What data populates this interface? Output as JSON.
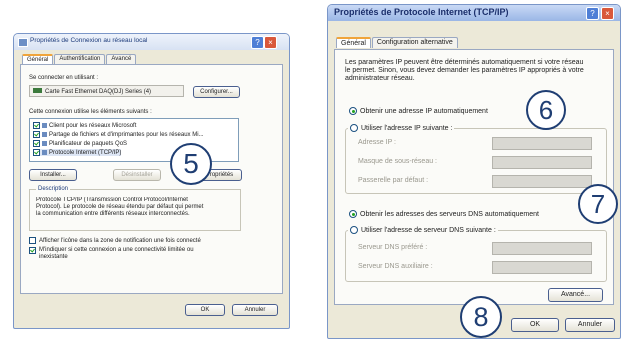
{
  "left_dialog": {
    "title": "Propriétés de Connexion au réseau local",
    "tabs": [
      "Général",
      "Authentification",
      "Avancé"
    ],
    "connect_using_label": "Se connecter en utilisant :",
    "adapter_name": "Carte Fast Ethernet DAQ(DJ) Series (4)",
    "configure_button": "Configurer...",
    "items_label": "Cette connexion utilise les éléments suivants :",
    "items": [
      {
        "label": "Client pour les réseaux Microsoft",
        "checked": true
      },
      {
        "label": "Partage de fichiers et d'imprimantes pour les réseaux Mi...",
        "checked": true
      },
      {
        "label": "Planificateur de paquets QoS",
        "checked": true
      },
      {
        "label": "Protocole Internet (TCP/IP)",
        "checked": true
      }
    ],
    "install_button": "Installer...",
    "uninstall_button": "Désinstaller",
    "properties_button": "Propriétés",
    "description_title": "Description",
    "description_text": "Protocole TCP/IP (Transmission Control Protocol/Internet Protocol). Le protocole de réseau étendu par défaut qui permet la communication entre différents réseaux interconnectés.",
    "show_icon_label": "Afficher l'icône dans la zone de notification une fois connecté",
    "notify_label": "M'indiquer si cette connexion a une connectivité limitée ou inexistante",
    "ok_button": "OK",
    "cancel_button": "Annuler"
  },
  "right_dialog": {
    "title": "Propriétés de Protocole Internet (TCP/IP)",
    "tabs": [
      "Général",
      "Configuration alternative"
    ],
    "intro_text": "Les paramètres IP peuvent être déterminés automatiquement si votre réseau le permet. Sinon, vous devez demander les paramètres IP appropriés à votre administrateur réseau.",
    "ip_auto_label": "Obtenir une adresse IP automatiquement",
    "ip_manual_label": "Utiliser l'adresse IP suivante :",
    "ip_address_label": "Adresse IP :",
    "subnet_label": "Masque de sous-réseau :",
    "gateway_label": "Passerelle par défaut :",
    "dns_auto_label": "Obtenir les adresses des serveurs DNS automatiquement",
    "dns_manual_label": "Utiliser l'adresse de serveur DNS suivante :",
    "dns_preferred_label": "Serveur DNS préféré :",
    "dns_alternate_label": "Serveur DNS auxiliaire :",
    "advanced_button": "Avancé...",
    "ok_button": "OK",
    "cancel_button": "Annuler"
  },
  "step_markers": {
    "five": "5",
    "six": "6",
    "seven": "7",
    "eight": "8"
  },
  "colors": {
    "marker_border": "#1f3e73",
    "dialog_face": "#ece9d8",
    "checkbox_tick": "#21a121"
  }
}
